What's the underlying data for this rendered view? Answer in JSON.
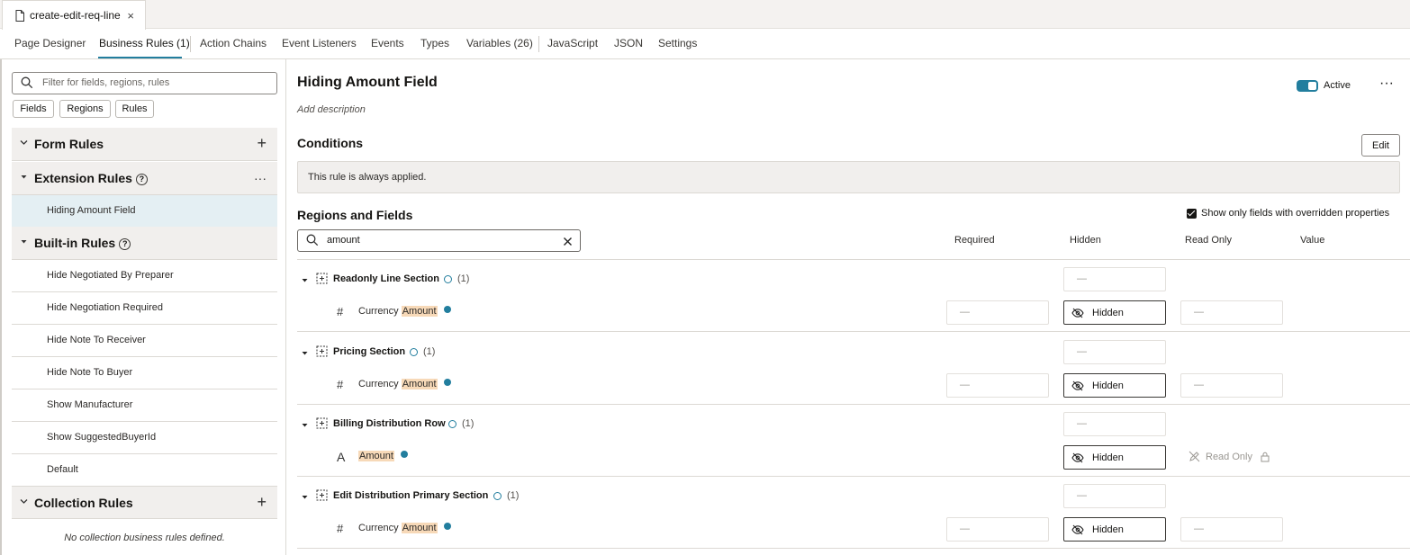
{
  "file_tab": {
    "name": "create-edit-req-line",
    "close": "×"
  },
  "designer_tabs": [
    {
      "label": "Page Designer"
    },
    {
      "label": "Business Rules (1)",
      "active": true
    },
    {
      "label": "Action Chains"
    },
    {
      "label": "Event Listeners"
    },
    {
      "label": "Events"
    },
    {
      "label": "Types"
    },
    {
      "label": "Variables (26)"
    },
    {
      "label": "JavaScript"
    },
    {
      "label": "JSON"
    },
    {
      "label": "Settings"
    }
  ],
  "left": {
    "filter_placeholder": "Filter for fields, regions, rules",
    "chips": [
      "Fields",
      "Regions",
      "Rules"
    ],
    "form_rules": {
      "title": "Form Rules",
      "action": "+"
    },
    "extension_rules": {
      "title": "Extension Rules",
      "action": "···",
      "items": [
        "Hiding Amount Field"
      ]
    },
    "builtin_rules": {
      "title": "Built-in Rules",
      "items": [
        "Hide Negotiated By Preparer",
        "Hide Negotiation Required",
        "Hide Note To Receiver",
        "Hide Note To Buyer",
        "Show Manufacturer",
        "Show SuggestedBuyerId",
        "Default"
      ]
    },
    "collection_rules": {
      "title": "Collection Rules",
      "action": "+",
      "empty": "No collection business rules defined."
    }
  },
  "main": {
    "title": "Hiding Amount Field",
    "description": "Add description",
    "active_label": "Active",
    "active": true,
    "more": "···",
    "conditions_heading": "Conditions",
    "edit_label": "Edit",
    "condition_text": "This rule is always applied.",
    "regions_heading": "Regions and Fields",
    "show_only_label": "Show only fields with overridden properties",
    "search_value": "amount",
    "columns": [
      "Required",
      "Hidden",
      "Read Only",
      "Value"
    ],
    "dash": "—",
    "groups": [
      {
        "title": "Readonly Line Section",
        "count": "(1)",
        "field_prefix": "Currency",
        "field_match": "Amount",
        "field_icon": "#",
        "hidden": "Hidden",
        "type": "number"
      },
      {
        "title": "Pricing Section",
        "count": "(1)",
        "field_prefix": "Currency",
        "field_match": "Amount",
        "field_icon": "#",
        "hidden": "Hidden",
        "type": "number"
      },
      {
        "title": "Billing Distribution Row",
        "count": "(1)",
        "field_prefix": "",
        "field_match": "Amount",
        "field_icon": "A",
        "hidden": "Hidden",
        "read_only": "Read Only",
        "type": "text"
      },
      {
        "title": "Edit Distribution Primary Section",
        "count": "(1)",
        "field_prefix": "Currency",
        "field_match": "Amount",
        "field_icon": "#",
        "hidden": "Hidden",
        "type": "number"
      }
    ]
  },
  "colors": {
    "accent": "#227e9e",
    "highlight": "#f7d9b8",
    "section_bg": "#f1efed",
    "selected_bg": "#e4eff3"
  }
}
